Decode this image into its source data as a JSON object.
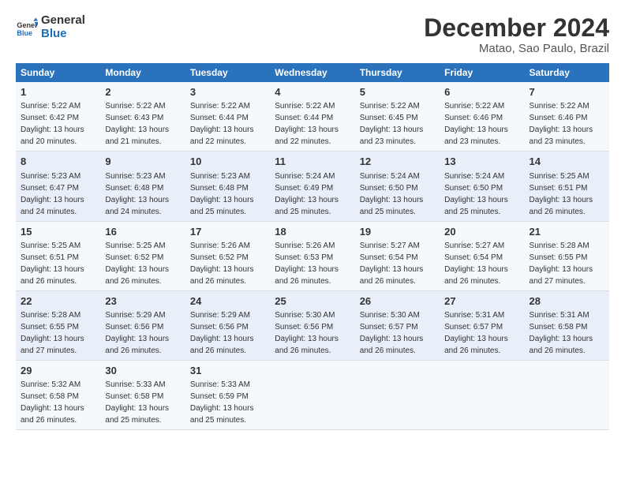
{
  "logo": {
    "line1": "General",
    "line2": "Blue"
  },
  "title": "December 2024",
  "subtitle": "Matao, Sao Paulo, Brazil",
  "days_header": [
    "Sunday",
    "Monday",
    "Tuesday",
    "Wednesday",
    "Thursday",
    "Friday",
    "Saturday"
  ],
  "weeks": [
    [
      {
        "day": "1",
        "sunrise": "5:22 AM",
        "sunset": "6:42 PM",
        "daylight": "13 hours and 20 minutes."
      },
      {
        "day": "2",
        "sunrise": "5:22 AM",
        "sunset": "6:43 PM",
        "daylight": "13 hours and 21 minutes."
      },
      {
        "day": "3",
        "sunrise": "5:22 AM",
        "sunset": "6:44 PM",
        "daylight": "13 hours and 22 minutes."
      },
      {
        "day": "4",
        "sunrise": "5:22 AM",
        "sunset": "6:44 PM",
        "daylight": "13 hours and 22 minutes."
      },
      {
        "day": "5",
        "sunrise": "5:22 AM",
        "sunset": "6:45 PM",
        "daylight": "13 hours and 23 minutes."
      },
      {
        "day": "6",
        "sunrise": "5:22 AM",
        "sunset": "6:46 PM",
        "daylight": "13 hours and 23 minutes."
      },
      {
        "day": "7",
        "sunrise": "5:22 AM",
        "sunset": "6:46 PM",
        "daylight": "13 hours and 23 minutes."
      }
    ],
    [
      {
        "day": "8",
        "sunrise": "5:23 AM",
        "sunset": "6:47 PM",
        "daylight": "13 hours and 24 minutes."
      },
      {
        "day": "9",
        "sunrise": "5:23 AM",
        "sunset": "6:48 PM",
        "daylight": "13 hours and 24 minutes."
      },
      {
        "day": "10",
        "sunrise": "5:23 AM",
        "sunset": "6:48 PM",
        "daylight": "13 hours and 25 minutes."
      },
      {
        "day": "11",
        "sunrise": "5:24 AM",
        "sunset": "6:49 PM",
        "daylight": "13 hours and 25 minutes."
      },
      {
        "day": "12",
        "sunrise": "5:24 AM",
        "sunset": "6:50 PM",
        "daylight": "13 hours and 25 minutes."
      },
      {
        "day": "13",
        "sunrise": "5:24 AM",
        "sunset": "6:50 PM",
        "daylight": "13 hours and 25 minutes."
      },
      {
        "day": "14",
        "sunrise": "5:25 AM",
        "sunset": "6:51 PM",
        "daylight": "13 hours and 26 minutes."
      }
    ],
    [
      {
        "day": "15",
        "sunrise": "5:25 AM",
        "sunset": "6:51 PM",
        "daylight": "13 hours and 26 minutes."
      },
      {
        "day": "16",
        "sunrise": "5:25 AM",
        "sunset": "6:52 PM",
        "daylight": "13 hours and 26 minutes."
      },
      {
        "day": "17",
        "sunrise": "5:26 AM",
        "sunset": "6:52 PM",
        "daylight": "13 hours and 26 minutes."
      },
      {
        "day": "18",
        "sunrise": "5:26 AM",
        "sunset": "6:53 PM",
        "daylight": "13 hours and 26 minutes."
      },
      {
        "day": "19",
        "sunrise": "5:27 AM",
        "sunset": "6:54 PM",
        "daylight": "13 hours and 26 minutes."
      },
      {
        "day": "20",
        "sunrise": "5:27 AM",
        "sunset": "6:54 PM",
        "daylight": "13 hours and 26 minutes."
      },
      {
        "day": "21",
        "sunrise": "5:28 AM",
        "sunset": "6:55 PM",
        "daylight": "13 hours and 27 minutes."
      }
    ],
    [
      {
        "day": "22",
        "sunrise": "5:28 AM",
        "sunset": "6:55 PM",
        "daylight": "13 hours and 27 minutes."
      },
      {
        "day": "23",
        "sunrise": "5:29 AM",
        "sunset": "6:56 PM",
        "daylight": "13 hours and 26 minutes."
      },
      {
        "day": "24",
        "sunrise": "5:29 AM",
        "sunset": "6:56 PM",
        "daylight": "13 hours and 26 minutes."
      },
      {
        "day": "25",
        "sunrise": "5:30 AM",
        "sunset": "6:56 PM",
        "daylight": "13 hours and 26 minutes."
      },
      {
        "day": "26",
        "sunrise": "5:30 AM",
        "sunset": "6:57 PM",
        "daylight": "13 hours and 26 minutes."
      },
      {
        "day": "27",
        "sunrise": "5:31 AM",
        "sunset": "6:57 PM",
        "daylight": "13 hours and 26 minutes."
      },
      {
        "day": "28",
        "sunrise": "5:31 AM",
        "sunset": "6:58 PM",
        "daylight": "13 hours and 26 minutes."
      }
    ],
    [
      {
        "day": "29",
        "sunrise": "5:32 AM",
        "sunset": "6:58 PM",
        "daylight": "13 hours and 26 minutes."
      },
      {
        "day": "30",
        "sunrise": "5:33 AM",
        "sunset": "6:58 PM",
        "daylight": "13 hours and 25 minutes."
      },
      {
        "day": "31",
        "sunrise": "5:33 AM",
        "sunset": "6:59 PM",
        "daylight": "13 hours and 25 minutes."
      },
      null,
      null,
      null,
      null
    ]
  ]
}
